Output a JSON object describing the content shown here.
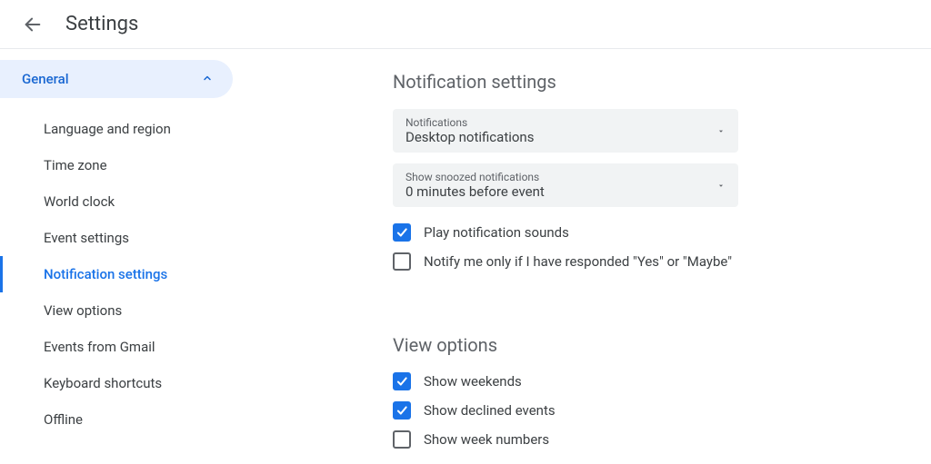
{
  "header": {
    "title": "Settings"
  },
  "sidebar": {
    "group_label": "General",
    "items": [
      {
        "label": "Language and region",
        "active": false
      },
      {
        "label": "Time zone",
        "active": false
      },
      {
        "label": "World clock",
        "active": false
      },
      {
        "label": "Event settings",
        "active": false
      },
      {
        "label": "Notification settings",
        "active": true
      },
      {
        "label": "View options",
        "active": false
      },
      {
        "label": "Events from Gmail",
        "active": false
      },
      {
        "label": "Keyboard shortcuts",
        "active": false
      },
      {
        "label": "Offline",
        "active": false
      }
    ]
  },
  "notification_settings": {
    "title": "Notification settings",
    "notifications_dd": {
      "label": "Notifications",
      "value": "Desktop notifications"
    },
    "snoozed_dd": {
      "label": "Show snoozed notifications",
      "value": "0 minutes before event"
    },
    "play_sounds": {
      "label": "Play notification sounds",
      "checked": true
    },
    "notify_only_responded": {
      "label": "Notify me only if I have responded \"Yes\" or \"Maybe\"",
      "checked": false
    }
  },
  "view_options": {
    "title": "View options",
    "show_weekends": {
      "label": "Show weekends",
      "checked": true
    },
    "show_declined": {
      "label": "Show declined events",
      "checked": true
    },
    "show_week_numbers": {
      "label": "Show week numbers",
      "checked": false
    }
  }
}
